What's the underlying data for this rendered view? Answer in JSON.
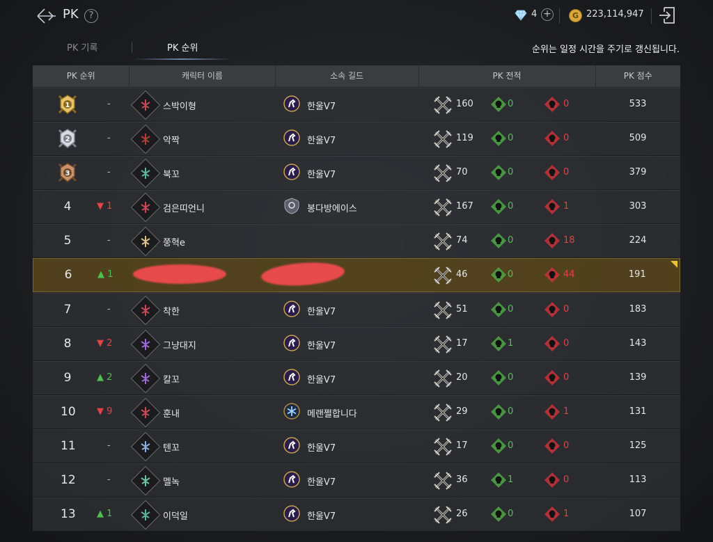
{
  "header": {
    "title": "PK",
    "help": "?",
    "gems": "4",
    "gold": "223,114,947",
    "gold_symbol": "G"
  },
  "tabs": [
    {
      "label": "PK 기록",
      "active": false
    },
    {
      "label": "PK 순위",
      "active": true
    }
  ],
  "notice": "순위는 일정 시간을 주기로 갱신됩니다.",
  "columns": [
    "PK 순위",
    "캐릭터 이름",
    "소속 길드",
    "PK 전적",
    "PK 점수"
  ],
  "colors": {
    "up": "#4fbf4f",
    "down": "#e04545",
    "assist": "#58c058",
    "highlight": "#584620"
  },
  "rows": [
    {
      "rank": "1",
      "change": "-",
      "dir": "none",
      "medal": "gold",
      "name": "스박이형",
      "guild": "한울V7",
      "guild_icon": "horse-emblem-icon",
      "kills": "160",
      "assists": "0",
      "deaths": "0",
      "score": "533"
    },
    {
      "rank": "2",
      "change": "-",
      "dir": "none",
      "medal": "silver",
      "name": "악짝",
      "guild": "한울V7",
      "guild_icon": "horse-emblem-icon",
      "kills": "119",
      "assists": "0",
      "deaths": "0",
      "score": "509"
    },
    {
      "rank": "3",
      "change": "-",
      "dir": "none",
      "medal": "bronze",
      "name": "북꼬",
      "guild": "한울V7",
      "guild_icon": "horse-emblem-icon",
      "kills": "70",
      "assists": "0",
      "deaths": "0",
      "score": "379"
    },
    {
      "rank": "4",
      "change": "1",
      "dir": "down",
      "name": "검은띠언니",
      "guild": "봉다방에이스",
      "guild_icon": "shield-emblem-icon",
      "kills": "167",
      "assists": "0",
      "deaths": "1",
      "score": "303"
    },
    {
      "rank": "5",
      "change": "-",
      "dir": "none",
      "name": "쭝혁e",
      "guild": "",
      "guild_icon": "",
      "kills": "74",
      "assists": "0",
      "deaths": "18",
      "score": "224"
    },
    {
      "rank": "6",
      "change": "1",
      "dir": "up",
      "name": "",
      "guild": "",
      "guild_icon": "",
      "redacted": true,
      "highlight": true,
      "kills": "46",
      "assists": "0",
      "deaths": "44",
      "score": "191"
    },
    {
      "rank": "7",
      "change": "-",
      "dir": "none",
      "name": "착한",
      "guild": "한울V7",
      "guild_icon": "horse-emblem-icon",
      "kills": "51",
      "assists": "0",
      "deaths": "0",
      "score": "183"
    },
    {
      "rank": "8",
      "change": "2",
      "dir": "down",
      "name": "그냥대지",
      "guild": "한울V7",
      "guild_icon": "horse-emblem-icon",
      "kills": "17",
      "assists": "1",
      "deaths": "0",
      "score": "143"
    },
    {
      "rank": "9",
      "change": "2",
      "dir": "up",
      "name": "칼꼬",
      "guild": "한울V7",
      "guild_icon": "horse-emblem-icon",
      "kills": "20",
      "assists": "0",
      "deaths": "0",
      "score": "139"
    },
    {
      "rank": "10",
      "change": "9",
      "dir": "down",
      "name": "훈내",
      "guild": "메랜쩔합니다",
      "guild_icon": "snowflake-emblem-icon",
      "kills": "29",
      "assists": "0",
      "deaths": "1",
      "score": "131"
    },
    {
      "rank": "11",
      "change": "-",
      "dir": "none",
      "name": "텐꼬",
      "guild": "한울V7",
      "guild_icon": "horse-emblem-icon",
      "kills": "17",
      "assists": "0",
      "deaths": "0",
      "score": "125"
    },
    {
      "rank": "12",
      "change": "-",
      "dir": "none",
      "name": "멜녹",
      "guild": "한울V7",
      "guild_icon": "horse-emblem-icon",
      "kills": "36",
      "assists": "1",
      "deaths": "0",
      "score": "113"
    },
    {
      "rank": "13",
      "change": "1",
      "dir": "up",
      "name": "이덕일",
      "guild": "한울V7",
      "guild_icon": "horse-emblem-icon",
      "kills": "26",
      "assists": "0",
      "deaths": "1",
      "score": "107"
    }
  ]
}
